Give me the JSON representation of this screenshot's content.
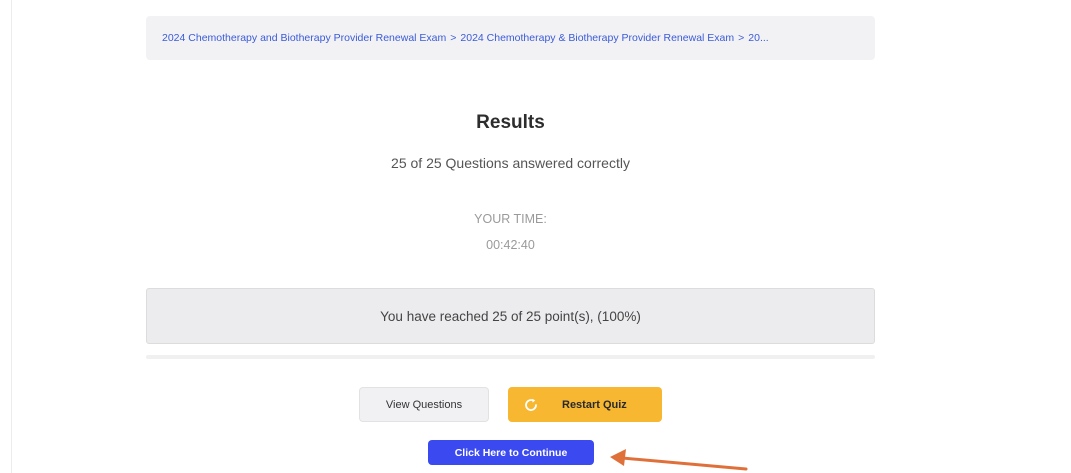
{
  "breadcrumb": {
    "items": [
      "2024 Chemotherapy and Biotherapy Provider Renewal Exam",
      "2024 Chemotherapy & Biotherapy Provider Renewal Exam",
      "20..."
    ],
    "separator": ">"
  },
  "results": {
    "title": "Results",
    "correct_text": "25 of 25 Questions answered correctly",
    "time_label": "YOUR TIME:",
    "time_value": "00:42:40",
    "points_text": "You have reached 25 of 25 point(s), (100%)"
  },
  "buttons": {
    "view_questions": "View Questions",
    "restart_quiz": "Restart Quiz",
    "continue": "Click Here to Continue"
  },
  "icons": {
    "restart": "refresh-icon",
    "annotation": "arrow-icon"
  },
  "colors": {
    "link": "#3a5bd9",
    "restart_button": "#f7b731",
    "continue_button": "#3a49f0",
    "arrow": "#e0703a"
  }
}
